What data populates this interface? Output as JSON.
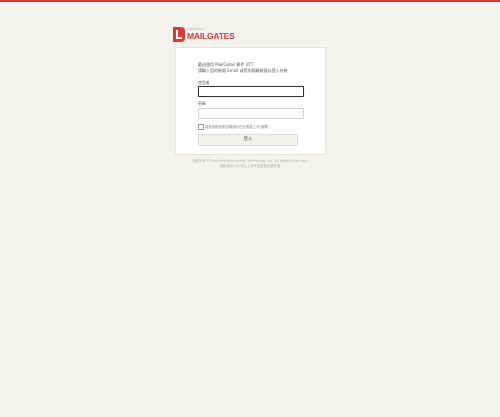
{
  "brand": {
    "logo_small_text": "Openfind",
    "logo_name": "MAILGATES",
    "accent_color": "#d93a36"
  },
  "login": {
    "welcome_line1": "歡迎使用 MailGates 郵件 UTT",
    "welcome_line2": "請輸入您的帳號 Email 或您的隔離帳號以登入系統",
    "account_label": "使用者",
    "password_label": "密碼",
    "remember_label": "將我的帳號和密碼儲存在此電腦上(可選擇)",
    "login_button": "登入"
  },
  "footer": {
    "line1": "版權所有 © Openfind Information Technology, Inc. All Rights Reserved.",
    "line2": "建議使用 IE9 或以上版本瀏覽器及解析度"
  }
}
